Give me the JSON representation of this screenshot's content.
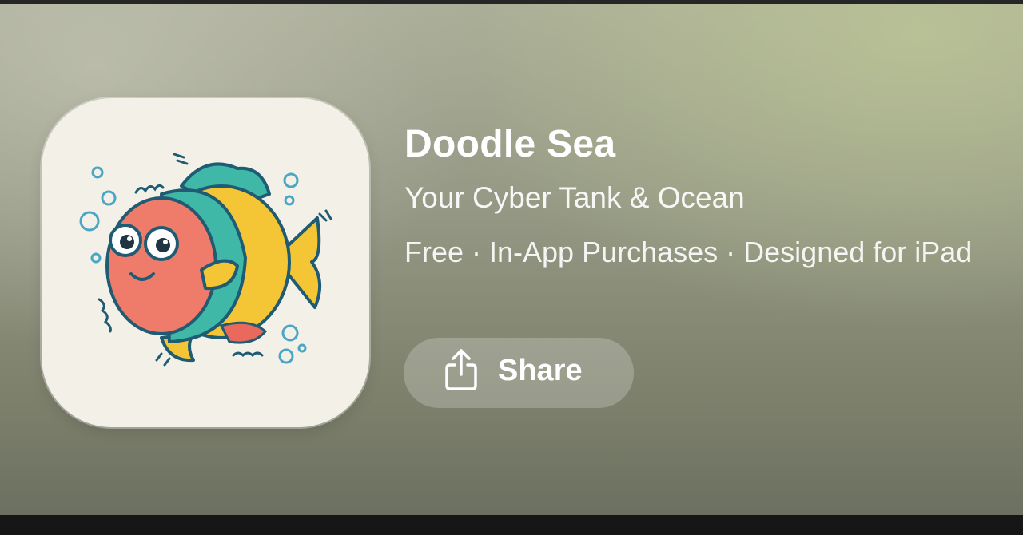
{
  "app": {
    "name": "Doodle Sea",
    "subtitle": "Your Cyber Tank & Ocean",
    "meta": "Free · In-App Purchases · Designed for iPad",
    "icon": "doodle-fish-icon"
  },
  "actions": {
    "share_label": "Share",
    "share_icon": "share-icon"
  },
  "colors": {
    "title_text": "#ffffff",
    "icon_background": "#f3f0e8",
    "fish_red": "#ef7b6b",
    "fish_teal": "#3fb8a8",
    "fish_yellow": "#f4c534",
    "outline": "#1f5b73"
  }
}
